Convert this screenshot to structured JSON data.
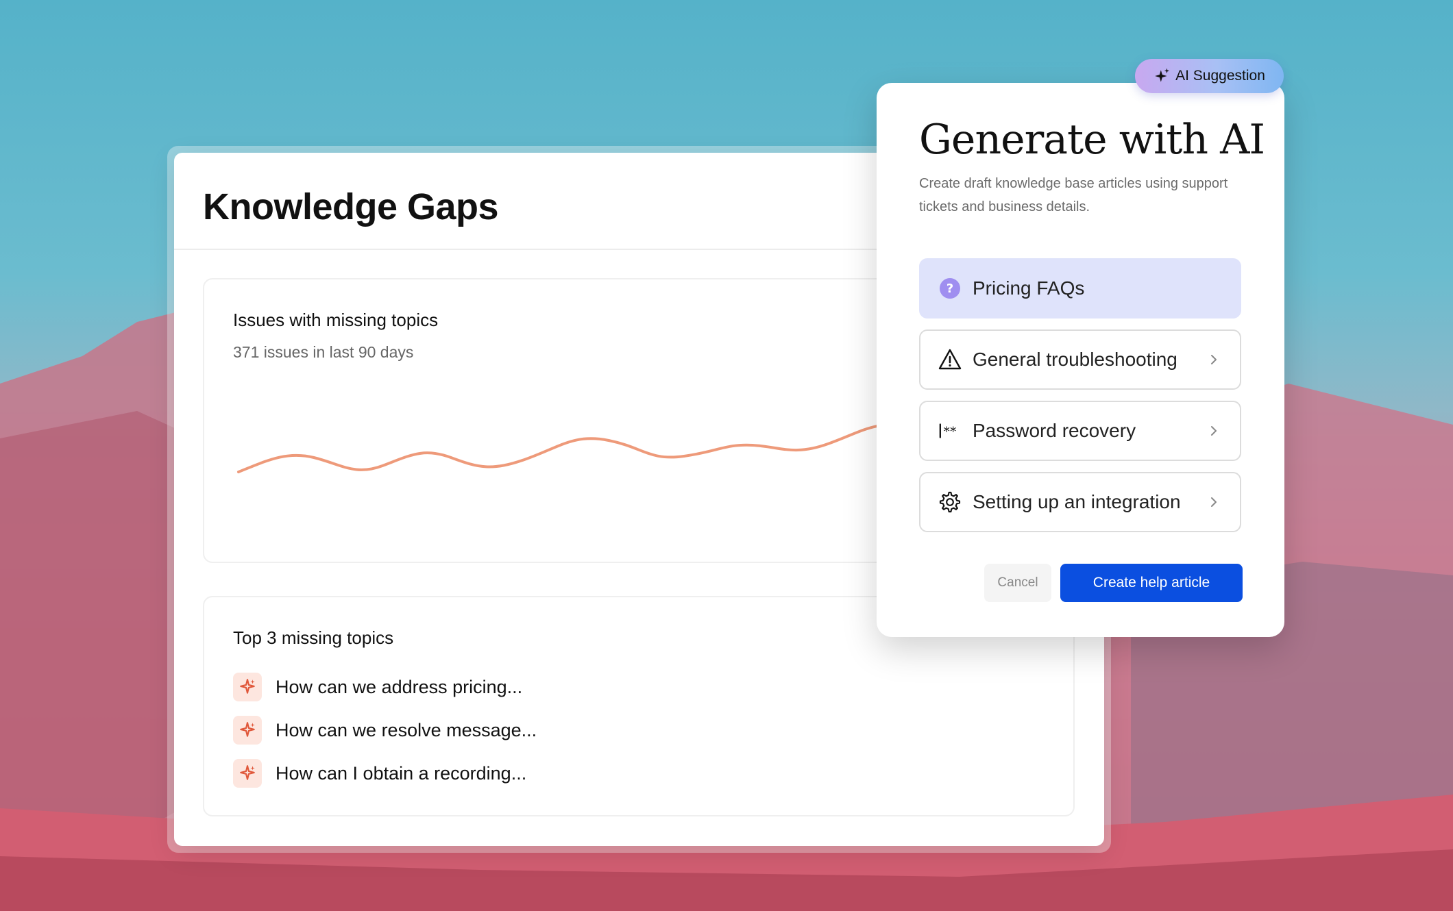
{
  "knowledge_gaps": {
    "title": "Knowledge Gaps",
    "issues_panel": {
      "title": "Issues with missing topics",
      "subtitle": "371 issues in last 90 days",
      "line_color": "#ee9a7a"
    },
    "topics_panel": {
      "title": "Top 3 missing topics",
      "items": [
        {
          "icon": "sparkle-icon",
          "label": "How can we address pricing..."
        },
        {
          "icon": "sparkle-icon",
          "label": "How can we resolve message..."
        },
        {
          "icon": "sparkle-icon",
          "label": "How can I obtain a recording..."
        }
      ]
    }
  },
  "ai_modal": {
    "badge": {
      "icon": "sparkle-icon",
      "label": "AI Suggestion"
    },
    "title": "Generate with AI",
    "description": "Create draft knowledge base articles using support tickets and business details.",
    "options": [
      {
        "icon": "question-circle-icon",
        "label": "Pricing FAQs",
        "selected": true
      },
      {
        "icon": "warning-triangle-icon",
        "label": "General troubleshooting",
        "selected": false
      },
      {
        "icon": "password-icon",
        "label": "Password recovery",
        "selected": false
      },
      {
        "icon": "gear-icon",
        "label": "Setting up an integration",
        "selected": false
      }
    ],
    "cancel_label": "Cancel",
    "create_label": "Create help article"
  },
  "colors": {
    "accent_blue": "#0b4fe0",
    "selected_option_bg": "#dfe3fb",
    "topic_icon_bg": "#fde6df",
    "topic_icon_color": "#e0573a"
  }
}
